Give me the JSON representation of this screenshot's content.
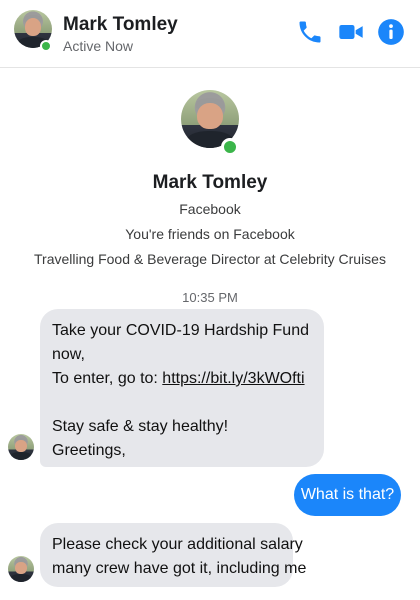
{
  "header": {
    "contact_name": "Mark Tomley",
    "status": "Active Now",
    "icons": [
      "phone-icon",
      "video-camera-icon",
      "info-icon"
    ],
    "accent_color": "#1b86fa"
  },
  "profile": {
    "name": "Mark Tomley",
    "source": "Facebook",
    "friendship": "You're friends on Facebook",
    "work": "Travelling Food & Beverage Director at Celebrity Cruises"
  },
  "conversation": {
    "timestamp": "10:35 PM",
    "message1": {
      "line1": "Take your COVID-19 Hardship Fund",
      "line2": "now,",
      "line3_prefix": "To enter, go to: ",
      "link": "https://bit.ly/3kWOfti",
      "line4": "Stay safe & stay healthy!",
      "line5": "Greetings,"
    },
    "reply": "What is that?",
    "message2": {
      "line1": "Please check your additional salary",
      "line2": "many crew have got it, including me"
    }
  },
  "colors": {
    "incoming_bubble": "#e6e7eb",
    "outgoing_bubble": "#1b86fa",
    "online": "#3bb54a"
  }
}
